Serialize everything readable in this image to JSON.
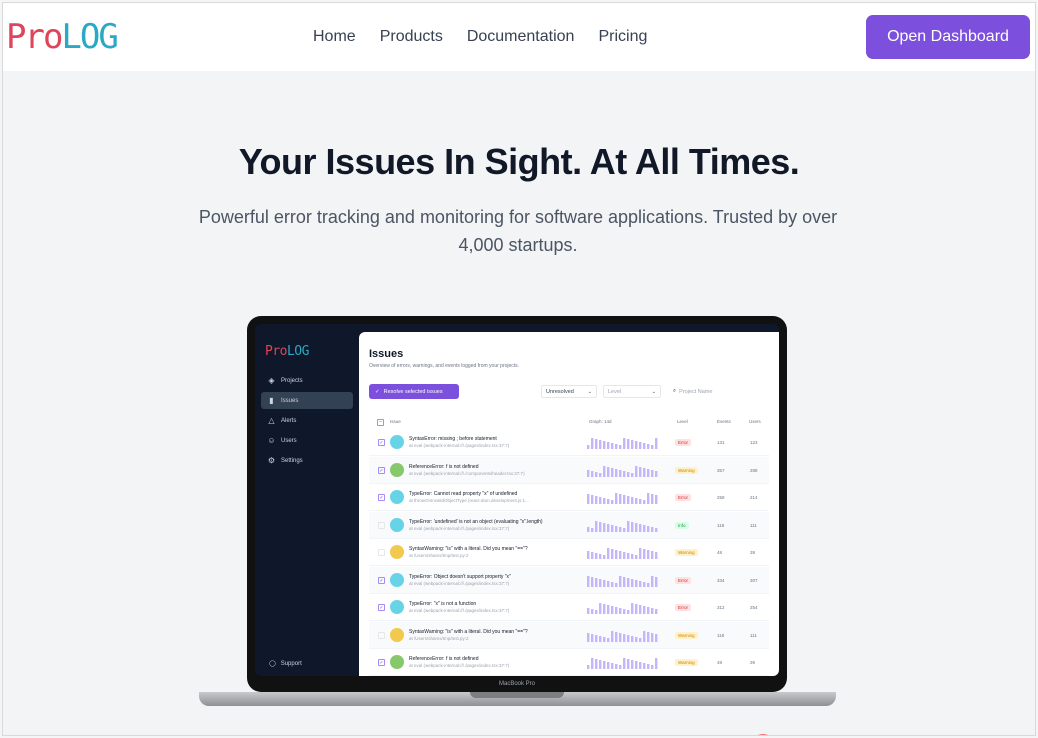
{
  "brand": {
    "logo_pro": "Pro",
    "logo_log": "LOG"
  },
  "nav": {
    "items": [
      "Home",
      "Products",
      "Documentation",
      "Pricing"
    ],
    "cta_label": "Open Dashboard"
  },
  "hero": {
    "title": "Your Issues In Sight. At All Times.",
    "subtitle": "Powerful error tracking and monitoring for software applications. Trusted by over 4,000 startups."
  },
  "app": {
    "logo_pro": "Pro",
    "logo_log": "LOG",
    "sidebar": [
      {
        "label": "Projects",
        "icon": "layers-icon",
        "glyph": "◈",
        "active": false
      },
      {
        "label": "Issues",
        "icon": "bar-chart-icon",
        "glyph": "▮",
        "active": true
      },
      {
        "label": "Alerts",
        "icon": "alert-triangle-icon",
        "glyph": "△",
        "active": false
      },
      {
        "label": "Users",
        "icon": "users-icon",
        "glyph": "☺",
        "active": false
      },
      {
        "label": "Settings",
        "icon": "gear-icon",
        "glyph": "⚙",
        "active": false
      }
    ],
    "support_label": "Support",
    "title": "Issues",
    "description": "Overview of errors, warnings, and events logged from your projects.",
    "resolve_button": "Resolve selected issues",
    "status_select": "Unresolved",
    "level_select": "Level",
    "search_placeholder": "Project Name",
    "columns": [
      "Issue",
      "Graph: 14d",
      "Level",
      "Events",
      "Users"
    ],
    "rows": [
      {
        "title": "SyntaxError: missing ; before statement",
        "path": "at eval (webpack-internal:///./pages/index.tsx:37:7)",
        "level": "Error",
        "events": "131",
        "users": "123",
        "checked": true,
        "avatar": "#67d3e6"
      },
      {
        "title": "ReferenceError: f is not defined",
        "path": "at eval (webpack-internal:///./components/header.tsx:37:7)",
        "level": "Warning",
        "events": "357",
        "users": "288",
        "checked": true,
        "avatar": "#86c86a"
      },
      {
        "title": "TypeError: Cannot read property \"x\" of undefined",
        "path": "at throwOnInvalidObjectType (react-dom.development.js:1...",
        "level": "Error",
        "events": "258",
        "users": "214",
        "checked": true,
        "avatar": "#67d3e6"
      },
      {
        "title": "TypeError: 'undefined' is not an object (evaluating \"x\".length)",
        "path": "at eval (webpack-internal:///./pages/index.tsx:37:7)",
        "level": "Info",
        "events": "118",
        "users": "111",
        "checked": false,
        "avatar": "#67d3e6"
      },
      {
        "title": "SyntaxWarning: \"is\" with a literal. Did you mean \"==\"?",
        "path": "at /Users/shams/tmp/test.py:2",
        "level": "Warning",
        "events": "48",
        "users": "39",
        "checked": false,
        "avatar": "#f2c94c"
      },
      {
        "title": "TypeError: Object doesn't support property \"x\"",
        "path": "at eval (webpack-internal:///./pages/index.tsx:37:7)",
        "level": "Error",
        "events": "334",
        "users": "307",
        "checked": true,
        "avatar": "#67d3e6"
      },
      {
        "title": "TypeError: \"x\" is not a function",
        "path": "at eval (webpack-internal:///./pages/index.tsx:37:7)",
        "level": "Error",
        "events": "312",
        "users": "254",
        "checked": true,
        "avatar": "#67d3e6"
      },
      {
        "title": "SyntaxWarning: \"is\" with a literal. Did you mean \"==\"?",
        "path": "at /Users/shams/tmp/test.py:2",
        "level": "Warning",
        "events": "118",
        "users": "111",
        "checked": false,
        "avatar": "#f2c94c"
      },
      {
        "title": "ReferenceError: f is not defined",
        "path": "at eval (webpack-internal:///./pages/index.tsx:37:7)",
        "level": "Warning",
        "events": "48",
        "users": "39",
        "checked": true,
        "avatar": "#86c86a"
      }
    ]
  },
  "laptop_label": "MacBook Pro",
  "colors": {
    "accent": "#7c4fdc",
    "logo_red": "#e0445b",
    "logo_teal": "#2aa8c4"
  }
}
